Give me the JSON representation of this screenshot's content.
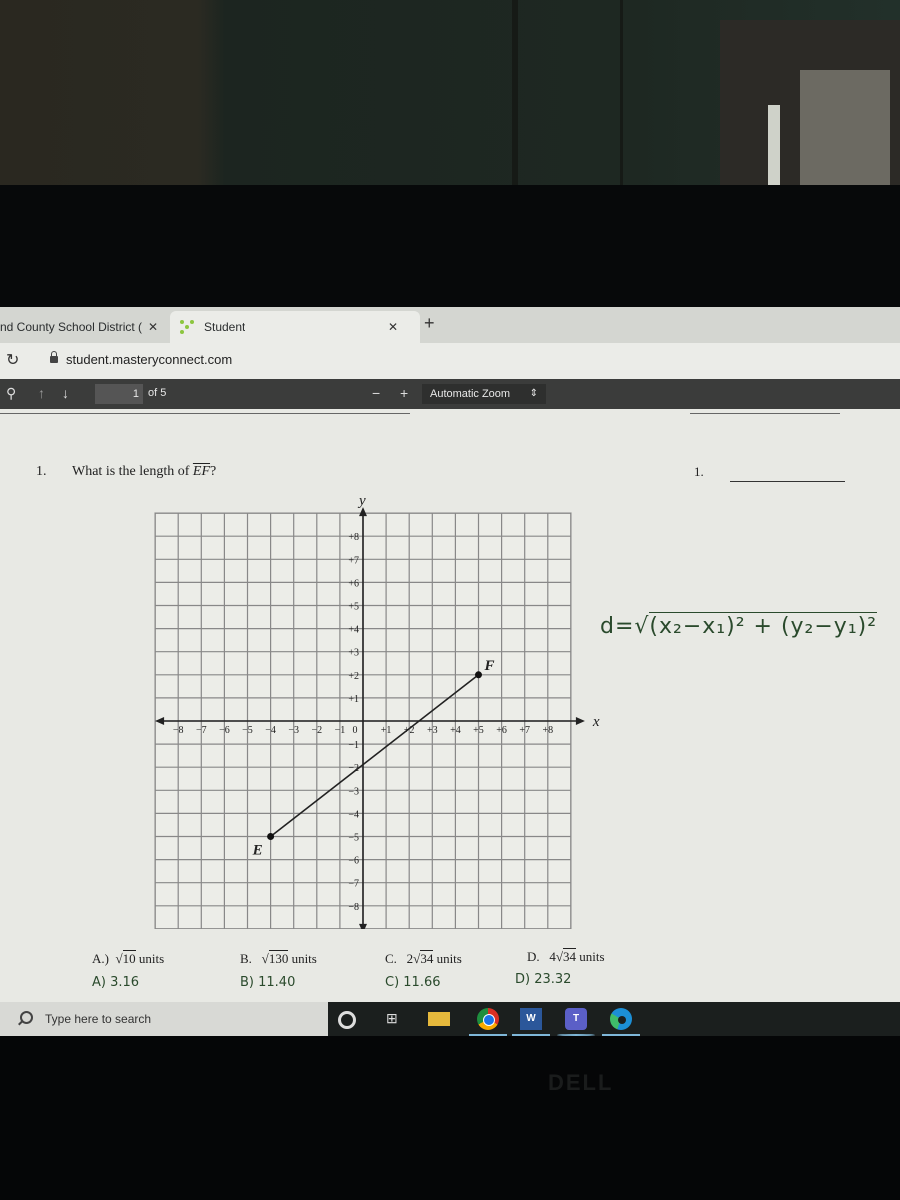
{
  "browser": {
    "tabs": [
      {
        "title": "nd County School District (",
        "active": false
      },
      {
        "title": "Student",
        "active": true
      }
    ],
    "url": "student.masteryconnect.com"
  },
  "pdf_toolbar": {
    "page_current": "1",
    "page_total_label": "of 5",
    "zoom_minus": "−",
    "zoom_plus": "+",
    "zoom_select": "Automatic Zoom"
  },
  "question": {
    "number": "1.",
    "text_prefix": "What is the length of ",
    "segment": "EF",
    "text_suffix": "?",
    "answer_number": "1."
  },
  "chart_data": {
    "type": "scatter",
    "title": "",
    "xlabel": "x",
    "ylabel": "y",
    "xlim": [
      -9,
      9
    ],
    "ylim": [
      -9,
      9
    ],
    "grid": true,
    "x_ticks": [
      "−8",
      "−7",
      "−6",
      "−5",
      "−4",
      "−3",
      "−2",
      "−1",
      "0",
      "+1",
      "+2",
      "+3",
      "+4",
      "+5",
      "+6",
      "+7",
      "+8"
    ],
    "y_ticks": [
      "+8",
      "+7",
      "+6",
      "+5",
      "+4",
      "+3",
      "+2",
      "+1",
      "−1",
      "−2",
      "−3",
      "−4",
      "−5",
      "−6",
      "−7",
      "−8"
    ],
    "points": [
      {
        "label": "E",
        "x": -4,
        "y": -5
      },
      {
        "label": "F",
        "x": 5,
        "y": 2
      }
    ],
    "segments": [
      {
        "from": "E",
        "to": "F"
      }
    ]
  },
  "formula_handwritten": "d=√(x₂−x₁)² + (y₂−y₁)²",
  "options": [
    {
      "letter": "A.)",
      "value": "√10 units",
      "radicand": "10",
      "coef": "",
      "handwritten": "A) 3.16"
    },
    {
      "letter": "B.",
      "value": "√130 units",
      "radicand": "130",
      "coef": "",
      "handwritten": "B) 11.40"
    },
    {
      "letter": "C.",
      "value": "2√34 units",
      "radicand": "34",
      "coef": "2",
      "handwritten": "C) 11.66"
    },
    {
      "letter": "D.",
      "value": "4√34 units",
      "radicand": "34",
      "coef": "4",
      "handwritten": "D) 23.32"
    }
  ],
  "units_label": "units",
  "taskbar": {
    "search_placeholder": "Type here to search",
    "apps": [
      "cortana",
      "task-view",
      "file-explorer",
      "chrome",
      "word",
      "teams",
      "edge"
    ],
    "word_letter": "W",
    "teams_letter": "T"
  },
  "monitor_brand": "DELL"
}
